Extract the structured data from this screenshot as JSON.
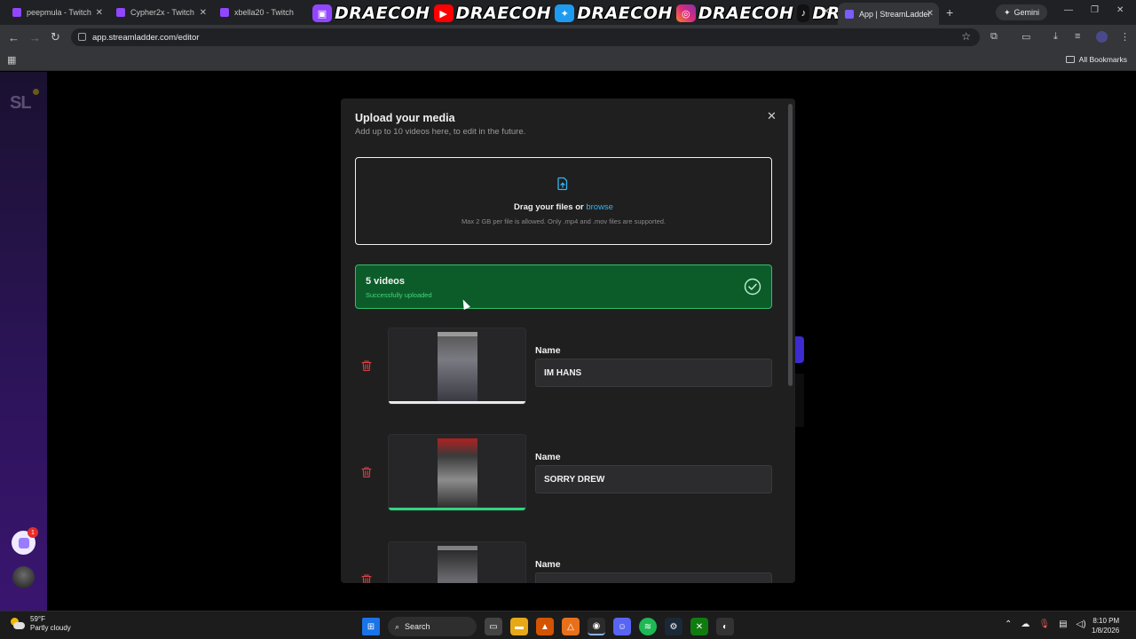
{
  "browser": {
    "tabs": [
      {
        "title": "peepmula - Twitch"
      },
      {
        "title": "Cypher2x - Twitch"
      },
      {
        "title": "xbella20 - Twitch"
      },
      {
        "title": "App | StreamLadder"
      }
    ],
    "gemini_label": "Gemini",
    "url": "app.streamladder.com/editor",
    "all_bookmarks": "All Bookmarks"
  },
  "overlay": {
    "handles": [
      "DRAECOH",
      "DRAECOH",
      "DRAECOH",
      "DRAECOH",
      "DRAECOH"
    ]
  },
  "app": {
    "logo": "SL",
    "notification_count": "1"
  },
  "modal": {
    "title": "Upload your media",
    "subtitle": "Add up to 10 videos here, to edit in the future.",
    "dropzone": {
      "main_text": "Drag your files or",
      "browse_text": "browse",
      "hint": "Max 2 GB per file is allowed. Only .mp4 and .mov files are supported."
    },
    "status": {
      "count": "5 videos",
      "message": "Successfully uploaded"
    },
    "videos": [
      {
        "name_label": "Name",
        "name": "IM HANS",
        "progress": 1.0
      },
      {
        "name_label": "Name",
        "name": "SORRY DREW",
        "progress": 1.0
      },
      {
        "name_label": "Name",
        "name": "",
        "progress": 0
      }
    ]
  },
  "taskbar": {
    "temperature": "59°F",
    "condition": "Partly cloudy",
    "search_label": "Search",
    "time": "8:10 PM",
    "date": "1/8/2026"
  }
}
